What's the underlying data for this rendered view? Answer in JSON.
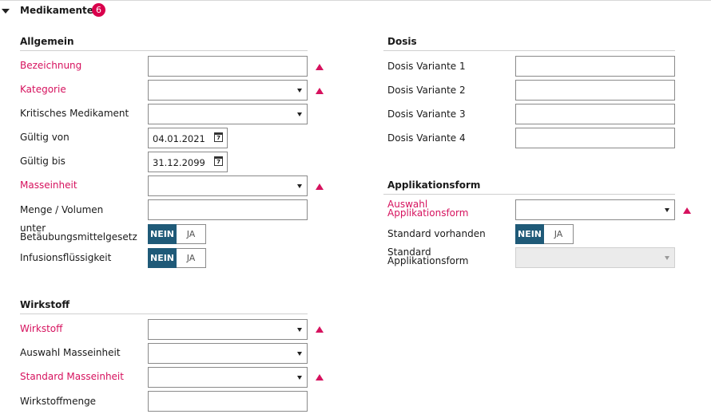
{
  "header": {
    "title": "Medikamente",
    "count": "6"
  },
  "allgemein": {
    "title": "Allgemein",
    "fields": {
      "bezeichnung": {
        "label": "Bezeichnung",
        "value": ""
      },
      "kategorie": {
        "label": "Kategorie",
        "value": ""
      },
      "kritisch": {
        "label": "Kritisches Medikament",
        "value": ""
      },
      "gueltig_von": {
        "label": "Gültig von",
        "value": "04.01.2021"
      },
      "gueltig_bis": {
        "label": "Gültig bis",
        "value": "31.12.2099"
      },
      "masseinheit": {
        "label": "Masseinheit",
        "value": ""
      },
      "menge": {
        "label": "Menge / Volumen",
        "value": ""
      },
      "btm": {
        "label": "unter Betäubungsmittelgesetz",
        "on": "NEIN",
        "off": "JA"
      },
      "infusion": {
        "label": "Infusionsflüssigkeit",
        "on": "NEIN",
        "off": "JA"
      }
    }
  },
  "wirkstoff": {
    "title": "Wirkstoff",
    "fields": {
      "wirkstoff": {
        "label": "Wirkstoff",
        "value": ""
      },
      "auswahl_masseinheit": {
        "label": "Auswahl Masseinheit",
        "value": ""
      },
      "standard_masseinheit": {
        "label": "Standard Masseinheit",
        "value": ""
      },
      "wirkstoffmenge": {
        "label": "Wirkstoffmenge",
        "value": ""
      }
    }
  },
  "dosis": {
    "title": "Dosis",
    "fields": {
      "v1": {
        "label": "Dosis Variante 1",
        "value": ""
      },
      "v2": {
        "label": "Dosis Variante 2",
        "value": ""
      },
      "v3": {
        "label": "Dosis Variante 3",
        "value": ""
      },
      "v4": {
        "label": "Dosis Variante 4",
        "value": ""
      }
    }
  },
  "applikation": {
    "title": "Applikationsform",
    "fields": {
      "auswahl": {
        "label": "Auswahl Applikationsform",
        "value": ""
      },
      "standard_vorhanden": {
        "label": "Standard vorhanden",
        "on": "NEIN",
        "off": "JA"
      },
      "standard": {
        "label": "Standard Applikationsform",
        "value": ""
      }
    }
  },
  "colors": {
    "required": "#d6125e",
    "toggle_active": "#1f5a78",
    "badge": "#d9004c"
  },
  "icons": {
    "collapse": "caret-down-icon",
    "calendar": "calendar-icon",
    "required": "required-triangle-icon",
    "dropdown": "chevron-down-icon"
  }
}
